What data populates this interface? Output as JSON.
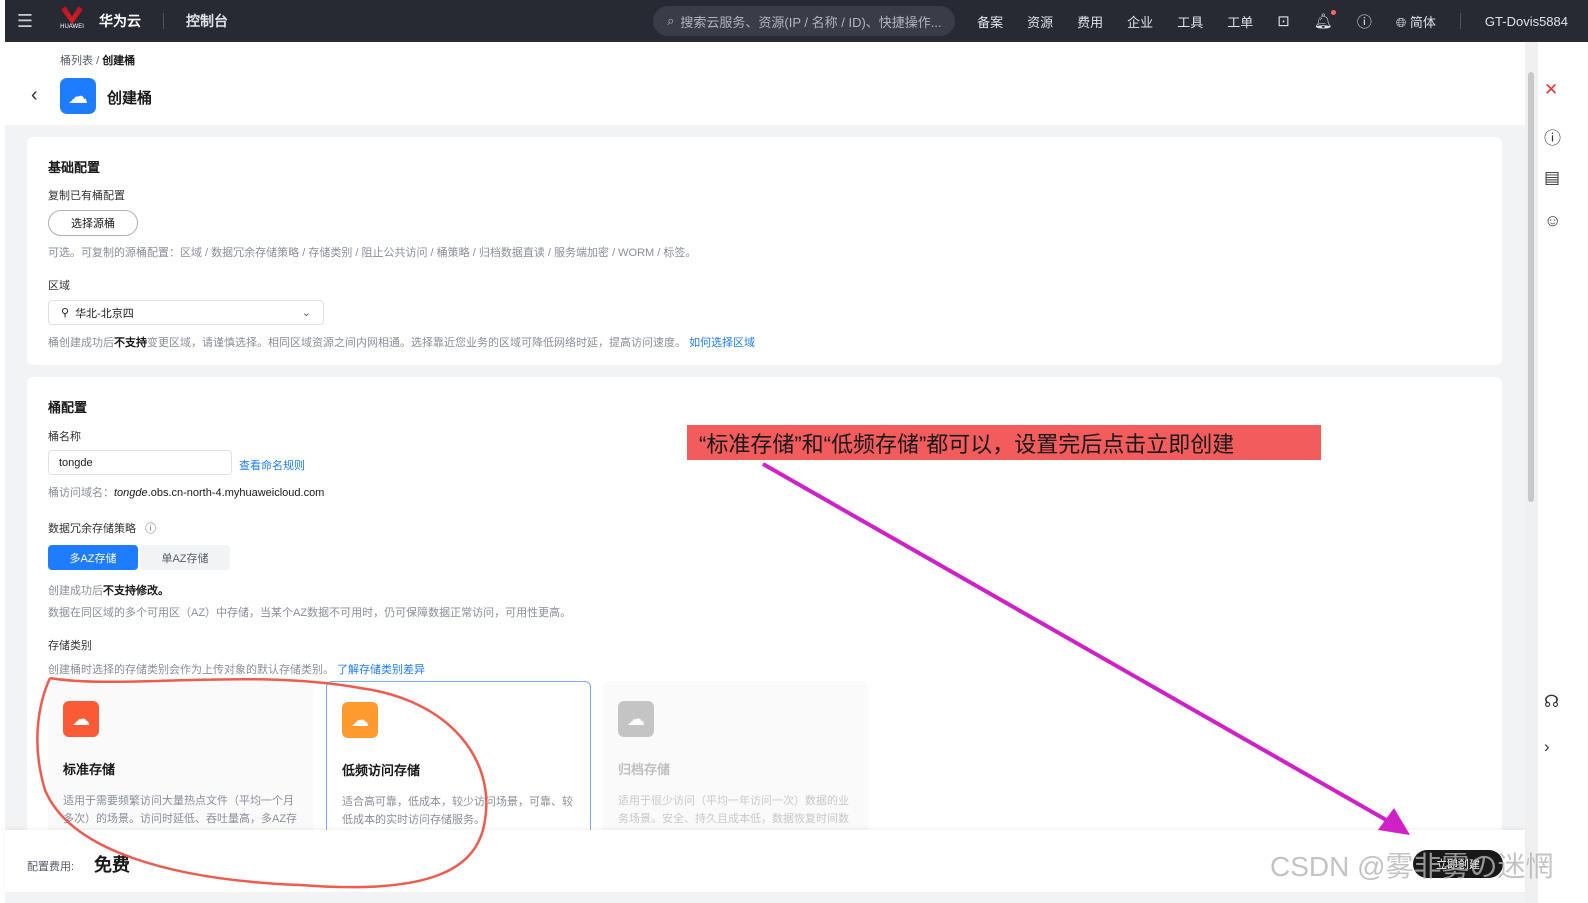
{
  "topbar": {
    "brand": "华为云",
    "logo_text": "HUAWEI",
    "console": "控制台",
    "search_placeholder": "搜索云服务、资源(IP / 名称 / ID)、快捷操作...",
    "nav": [
      "备案",
      "资源",
      "费用",
      "企业",
      "工具",
      "工单"
    ],
    "lang": "简体",
    "user": "GT-Dovis5884"
  },
  "header": {
    "breadcrumb_parent": "桶列表",
    "breadcrumb_sep": "/",
    "breadcrumb_current": "创建桶",
    "title": "创建桶"
  },
  "basic": {
    "title": "基础配置",
    "copy_label": "复制已有桶配置",
    "copy_button": "选择源桶",
    "copy_hint": "可选。可复制的源桶配置：区域 / 数据冗余存储策略 / 存储类别 / 阻止公共访问 / 桶策略 / 归档数据直读 / 服务端加密 / WORM / 标签。",
    "region_label": "区域",
    "region_value": "华北-北京四",
    "region_hint_pre": "桶创建成功后",
    "region_hint_bold": "不支持",
    "region_hint_post": "变更区域，请谨慎选择。相同区域资源之间内网相通。选择靠近您业务的区域可降低网络时延，提高访问速度。",
    "region_link": "如何选择区域"
  },
  "bucket": {
    "title": "桶配置",
    "name_label": "桶名称",
    "name_value": "tongde",
    "name_link": "查看命名规则",
    "domain_label": "桶访问域名：",
    "domain_name": "tongde",
    "domain_suffix": ".obs.cn-north-4.myhuaweicloud.com",
    "redundancy_label": "数据冗余存储策略",
    "redundancy_options": [
      "多AZ存储",
      "单AZ存储"
    ],
    "redundancy_hint_pre": "创建成功后",
    "redundancy_hint_bold": "不支持修改。",
    "redundancy_desc": "数据在同区域的多个可用区（AZ）中存储，当某个AZ数据不可用时，仍可保障数据正常访问，可用性更高。",
    "class_label": "存储类别",
    "class_hint": "创建桶时选择的存储类别会作为上传对象的默认存储类别。",
    "class_link": "了解存储类别差异",
    "classes": [
      {
        "title": "标准存储",
        "desc": "适用于需要频繁访问大量热点文件（平均一个月多次）的场景。访问时延低、吞吐量高，多AZ存储可靠性更高，单AZ存储成本更低",
        "color": "#fa5a36"
      },
      {
        "title": "低频访问存储",
        "desc": "适合高可靠，低成本，较少访问场景，可靠、较低成本的实时访问存储服务。",
        "color": "#ff9a2e"
      },
      {
        "title": "归档存储",
        "desc": "适用于很少访问（平均一年访问一次）数据的业务场景。安全、持久且成本低，数据恢复时间数分钟到数小时不等",
        "color": "#c4c4c4"
      }
    ]
  },
  "footer": {
    "fee_label": "配置费用:",
    "fee_value": "免费",
    "create_button": "立即创建"
  },
  "annotation": "“标准存储”和“低频存储”都可以，设置完后点击立即创建",
  "watermark": "CSDN @雾非雾の迷惘"
}
